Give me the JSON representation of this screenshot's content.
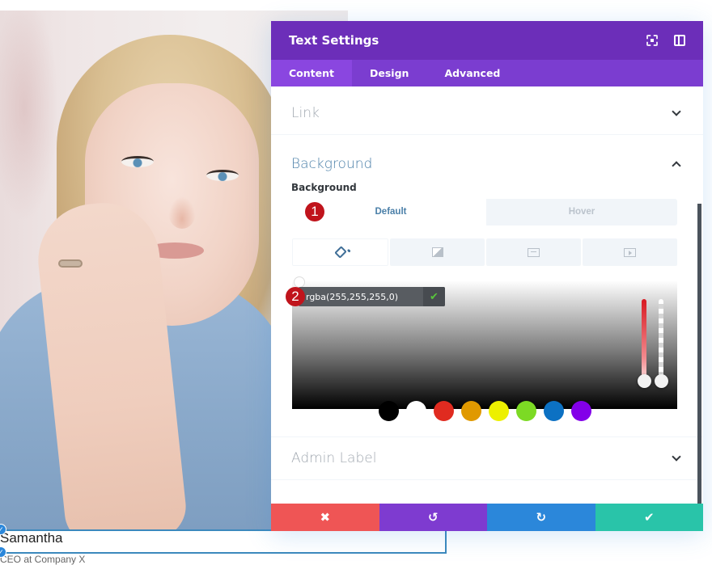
{
  "modal": {
    "title": "Text Settings",
    "header_icons": [
      "expand-icon",
      "sidebar-toggle-icon"
    ],
    "tabs": [
      {
        "label": "Content",
        "active": true
      },
      {
        "label": "Design",
        "active": false
      },
      {
        "label": "Advanced",
        "active": false
      }
    ],
    "sections": {
      "link": {
        "title": "Link",
        "expanded": false
      },
      "background": {
        "title": "Background",
        "expanded": true,
        "field_label": "Background",
        "states": [
          {
            "label": "Default",
            "active": true
          },
          {
            "label": "Hover",
            "active": false
          }
        ],
        "types": [
          {
            "icon": "paint-bucket-icon",
            "active": true
          },
          {
            "icon": "gradient-icon",
            "active": false
          },
          {
            "icon": "image-icon",
            "active": false
          },
          {
            "icon": "video-icon",
            "active": false
          }
        ],
        "color_picker": {
          "value": "rgba(255,255,255,0)",
          "confirm_icon": "checkmark-icon",
          "confirm_glyph": "✔",
          "hue_color": "#d81921",
          "swatches": [
            "#000000",
            "#ffffff",
            "#e02b20",
            "#e09900",
            "#edf000",
            "#7cda24",
            "#0c71c3",
            "#8300e9"
          ]
        }
      },
      "admin_label": {
        "title": "Admin Label",
        "expanded": false
      }
    },
    "annotations": [
      "1",
      "2"
    ],
    "footer": {
      "discard_glyph": "✖",
      "undo_glyph": "↺",
      "redo_glyph": "↻",
      "save_glyph": "✔"
    },
    "colors": {
      "header": "#6c2eb9",
      "tabs": "#7b3dd0",
      "discard": "#ef5555",
      "undo": "#7e3bd0",
      "redo": "#2b87da",
      "save": "#29c4a9"
    }
  },
  "page": {
    "person_name": "Samantha",
    "person_role": "CEO at Company X",
    "handle_glyph": "✓"
  }
}
